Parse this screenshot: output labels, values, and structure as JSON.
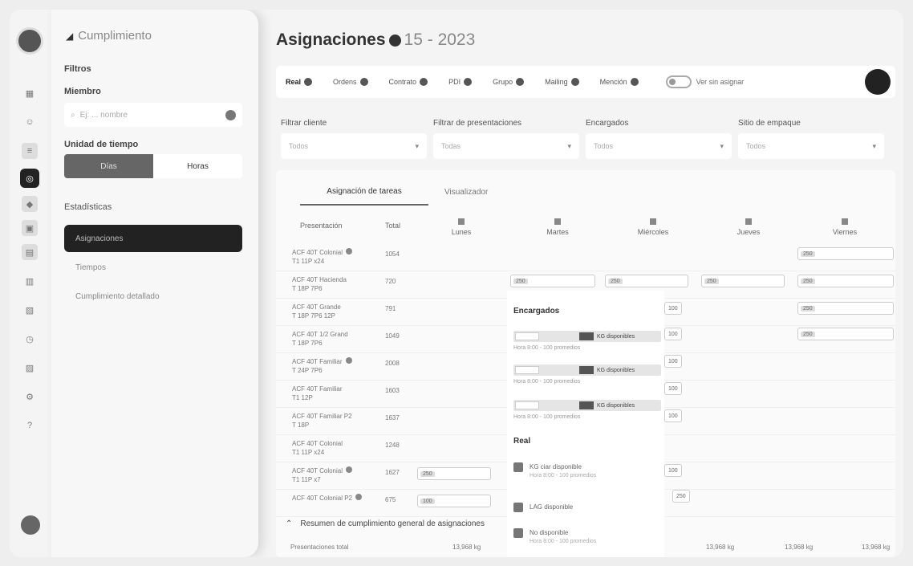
{
  "sidebar": {
    "title": "Cumplimiento",
    "filters_label": "Filtros",
    "member_label": "Miembro",
    "search_placeholder": "Ej: ... nombre",
    "unit_label": "Unidad de tiempo",
    "unit_options": [
      "Días",
      "Horas"
    ],
    "section_label": "Estadísticas",
    "nav": [
      "Asignaciones",
      "Tiempos",
      "Cumplimiento detallado"
    ]
  },
  "rail": {
    "icons": [
      "dashboard-icon",
      "users-icon",
      "layers-icon",
      "active-icon",
      "tag-icon",
      "box-icon",
      "chart-icon",
      "calendar-icon",
      "report-icon",
      "clock-icon",
      "doc-icon",
      "settings-icon",
      "help-icon"
    ]
  },
  "header": {
    "title": "Asignaciones",
    "period": "15 - 2023",
    "chips": [
      "Real",
      "Ordens",
      "Contrato",
      "PDI",
      "Grupo",
      "Mailing",
      "Mención"
    ],
    "toggle_label": "Ver sin asignar"
  },
  "filters": [
    {
      "label": "Filtrar cliente",
      "value": "Todos"
    },
    {
      "label": "Filtrar de presentaciones",
      "value": "Todas"
    },
    {
      "label": "Encargados",
      "value": "Todos"
    },
    {
      "label": "Sitio de empaque",
      "value": "Todos"
    }
  ],
  "content": {
    "tabs": [
      "Asignación de tareas",
      "Visualizador"
    ],
    "columns": [
      "Presentación",
      "Total",
      "Lunes",
      "Martes",
      "Miércoles",
      "Jueves",
      "Viernes"
    ],
    "rows": [
      {
        "name": "ACF 40T Colonial",
        "sub": "T1 11P x24",
        "total": "1054"
      },
      {
        "name": "ACF 40T Hacienda",
        "sub": "T 18P 7P6",
        "total": "720"
      },
      {
        "name": "ACF 40T Grande",
        "sub": "T 18P 7P6 12P",
        "total": "791"
      },
      {
        "name": "ACF 40T 1/2 Grand",
        "sub": "T 18P 7P6",
        "total": "1049"
      },
      {
        "name": "ACF 40T Familiar",
        "sub": "T 24P 7P6",
        "total": "2008"
      },
      {
        "name": "ACF 40T Familiar",
        "sub": "T1 12P",
        "total": "1603"
      },
      {
        "name": "ACF 40T Familiar P2",
        "sub": "T 18P",
        "total": "1637"
      },
      {
        "name": "ACF 40T Colonial",
        "sub": "T1 11P x24",
        "total": "1248"
      },
      {
        "name": "ACF 40T Colonial",
        "sub": "T1 11P x7",
        "total": "1627"
      },
      {
        "name": "ACF 40T Colonial P2",
        "sub": "",
        "total": "675"
      }
    ],
    "popover": {
      "section1": "Encargados",
      "options": [
        {
          "label": "KG disponibles",
          "sub": "Hora 8:00 - 100 promedios"
        },
        {
          "label": "KG disponibles",
          "sub": "Hora 8:00 - 100 promedios"
        },
        {
          "label": "KG disponibles",
          "sub": "Hora 8:00 - 100 promedios"
        }
      ],
      "section2": "Real",
      "checks": [
        {
          "label": "KG ciar disponible",
          "sub": "Hora 8:00 - 100 promedios"
        },
        {
          "label": "LAG disponible",
          "sub": ""
        },
        {
          "label": "No disponible",
          "sub": "Hora 8:00 - 100 promedios"
        }
      ]
    },
    "summary": "Resumen de cumplimiento general de asignaciones",
    "footer_label": "Presentaciones total",
    "footer_values": [
      "13,968 kg",
      "13,968 kg",
      "13,968 kg",
      "13,968 kg",
      "13,968 kg"
    ],
    "inputs": [
      "250",
      "100",
      "250"
    ]
  }
}
